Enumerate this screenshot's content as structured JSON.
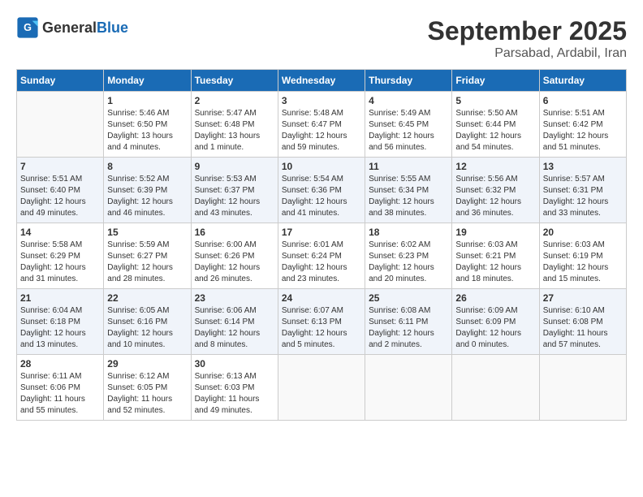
{
  "header": {
    "logo_general": "General",
    "logo_blue": "Blue",
    "month_title": "September 2025",
    "location": "Parsabad, Ardabil, Iran"
  },
  "days_of_week": [
    "Sunday",
    "Monday",
    "Tuesday",
    "Wednesday",
    "Thursday",
    "Friday",
    "Saturday"
  ],
  "weeks": [
    [
      {
        "day": "",
        "info": ""
      },
      {
        "day": "1",
        "info": "Sunrise: 5:46 AM\nSunset: 6:50 PM\nDaylight: 13 hours\nand 4 minutes."
      },
      {
        "day": "2",
        "info": "Sunrise: 5:47 AM\nSunset: 6:48 PM\nDaylight: 13 hours\nand 1 minute."
      },
      {
        "day": "3",
        "info": "Sunrise: 5:48 AM\nSunset: 6:47 PM\nDaylight: 12 hours\nand 59 minutes."
      },
      {
        "day": "4",
        "info": "Sunrise: 5:49 AM\nSunset: 6:45 PM\nDaylight: 12 hours\nand 56 minutes."
      },
      {
        "day": "5",
        "info": "Sunrise: 5:50 AM\nSunset: 6:44 PM\nDaylight: 12 hours\nand 54 minutes."
      },
      {
        "day": "6",
        "info": "Sunrise: 5:51 AM\nSunset: 6:42 PM\nDaylight: 12 hours\nand 51 minutes."
      }
    ],
    [
      {
        "day": "7",
        "info": "Sunrise: 5:51 AM\nSunset: 6:40 PM\nDaylight: 12 hours\nand 49 minutes."
      },
      {
        "day": "8",
        "info": "Sunrise: 5:52 AM\nSunset: 6:39 PM\nDaylight: 12 hours\nand 46 minutes."
      },
      {
        "day": "9",
        "info": "Sunrise: 5:53 AM\nSunset: 6:37 PM\nDaylight: 12 hours\nand 43 minutes."
      },
      {
        "day": "10",
        "info": "Sunrise: 5:54 AM\nSunset: 6:36 PM\nDaylight: 12 hours\nand 41 minutes."
      },
      {
        "day": "11",
        "info": "Sunrise: 5:55 AM\nSunset: 6:34 PM\nDaylight: 12 hours\nand 38 minutes."
      },
      {
        "day": "12",
        "info": "Sunrise: 5:56 AM\nSunset: 6:32 PM\nDaylight: 12 hours\nand 36 minutes."
      },
      {
        "day": "13",
        "info": "Sunrise: 5:57 AM\nSunset: 6:31 PM\nDaylight: 12 hours\nand 33 minutes."
      }
    ],
    [
      {
        "day": "14",
        "info": "Sunrise: 5:58 AM\nSunset: 6:29 PM\nDaylight: 12 hours\nand 31 minutes."
      },
      {
        "day": "15",
        "info": "Sunrise: 5:59 AM\nSunset: 6:27 PM\nDaylight: 12 hours\nand 28 minutes."
      },
      {
        "day": "16",
        "info": "Sunrise: 6:00 AM\nSunset: 6:26 PM\nDaylight: 12 hours\nand 26 minutes."
      },
      {
        "day": "17",
        "info": "Sunrise: 6:01 AM\nSunset: 6:24 PM\nDaylight: 12 hours\nand 23 minutes."
      },
      {
        "day": "18",
        "info": "Sunrise: 6:02 AM\nSunset: 6:23 PM\nDaylight: 12 hours\nand 20 minutes."
      },
      {
        "day": "19",
        "info": "Sunrise: 6:03 AM\nSunset: 6:21 PM\nDaylight: 12 hours\nand 18 minutes."
      },
      {
        "day": "20",
        "info": "Sunrise: 6:03 AM\nSunset: 6:19 PM\nDaylight: 12 hours\nand 15 minutes."
      }
    ],
    [
      {
        "day": "21",
        "info": "Sunrise: 6:04 AM\nSunset: 6:18 PM\nDaylight: 12 hours\nand 13 minutes."
      },
      {
        "day": "22",
        "info": "Sunrise: 6:05 AM\nSunset: 6:16 PM\nDaylight: 12 hours\nand 10 minutes."
      },
      {
        "day": "23",
        "info": "Sunrise: 6:06 AM\nSunset: 6:14 PM\nDaylight: 12 hours\nand 8 minutes."
      },
      {
        "day": "24",
        "info": "Sunrise: 6:07 AM\nSunset: 6:13 PM\nDaylight: 12 hours\nand 5 minutes."
      },
      {
        "day": "25",
        "info": "Sunrise: 6:08 AM\nSunset: 6:11 PM\nDaylight: 12 hours\nand 2 minutes."
      },
      {
        "day": "26",
        "info": "Sunrise: 6:09 AM\nSunset: 6:09 PM\nDaylight: 12 hours\nand 0 minutes."
      },
      {
        "day": "27",
        "info": "Sunrise: 6:10 AM\nSunset: 6:08 PM\nDaylight: 11 hours\nand 57 minutes."
      }
    ],
    [
      {
        "day": "28",
        "info": "Sunrise: 6:11 AM\nSunset: 6:06 PM\nDaylight: 11 hours\nand 55 minutes."
      },
      {
        "day": "29",
        "info": "Sunrise: 6:12 AM\nSunset: 6:05 PM\nDaylight: 11 hours\nand 52 minutes."
      },
      {
        "day": "30",
        "info": "Sunrise: 6:13 AM\nSunset: 6:03 PM\nDaylight: 11 hours\nand 49 minutes."
      },
      {
        "day": "",
        "info": ""
      },
      {
        "day": "",
        "info": ""
      },
      {
        "day": "",
        "info": ""
      },
      {
        "day": "",
        "info": ""
      }
    ]
  ]
}
